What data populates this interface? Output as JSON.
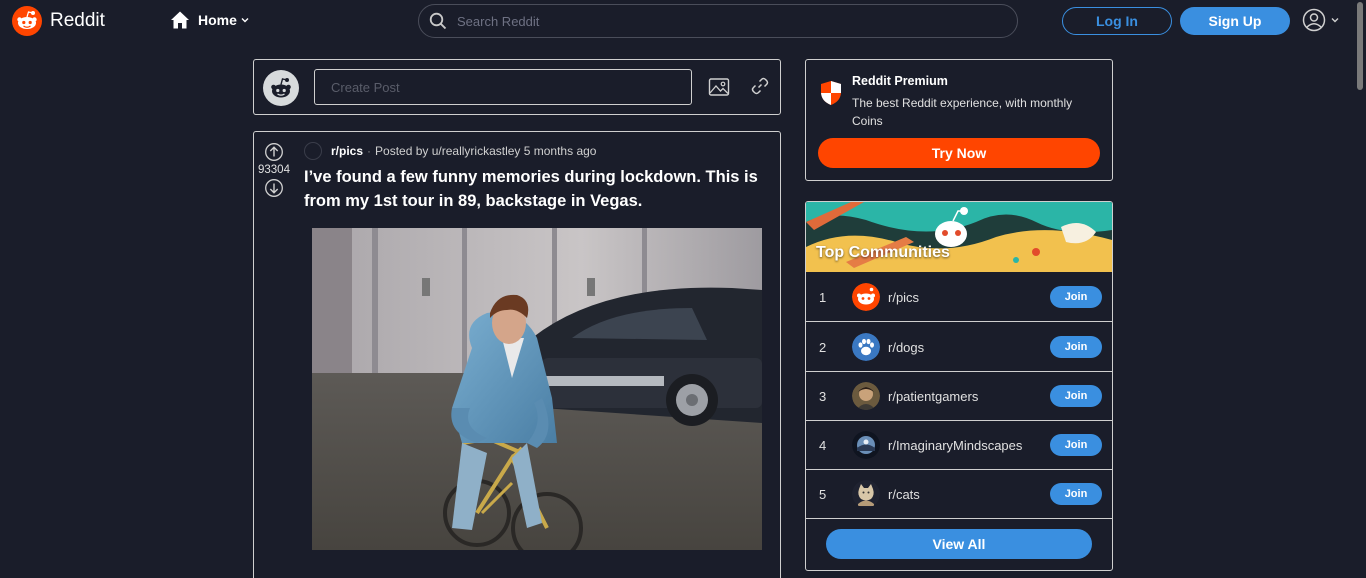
{
  "header": {
    "brand": "Reddit",
    "home_label": "Home",
    "search_placeholder": "Search Reddit",
    "login_label": "Log In",
    "signup_label": "Sign Up"
  },
  "create_post": {
    "placeholder": "Create Post"
  },
  "post": {
    "subreddit": "r/pics",
    "separator": "·",
    "posted_by": "Posted by u/reallyrickastley 5 months ago",
    "votes": "93304",
    "title": "I’ve found a few funny memories during lockdown. This is from my 1st tour in 89, backstage in Vegas."
  },
  "premium": {
    "title": "Reddit Premium",
    "description": "The best Reddit experience, with monthly Coins",
    "cta": "Try Now"
  },
  "top_communities": {
    "title": "Top Communities",
    "items": [
      {
        "rank": "1",
        "name": "r/pics",
        "join": "Join",
        "icon": "reddit-snoo-icon"
      },
      {
        "rank": "2",
        "name": "r/dogs",
        "join": "Join",
        "icon": "paw-icon"
      },
      {
        "rank": "3",
        "name": "r/patientgamers",
        "join": "Join",
        "icon": "avatar-icon"
      },
      {
        "rank": "4",
        "name": "r/ImaginaryMindscapes",
        "join": "Join",
        "icon": "landscape-icon"
      },
      {
        "rank": "5",
        "name": "r/cats",
        "join": "Join",
        "icon": "cat-icon"
      }
    ],
    "view_all": "View All"
  },
  "colors": {
    "background": "#1a1d2a",
    "accent_blue": "#3a8fe0",
    "accent_orange": "#ff4500",
    "border": "#cfcfcf"
  }
}
